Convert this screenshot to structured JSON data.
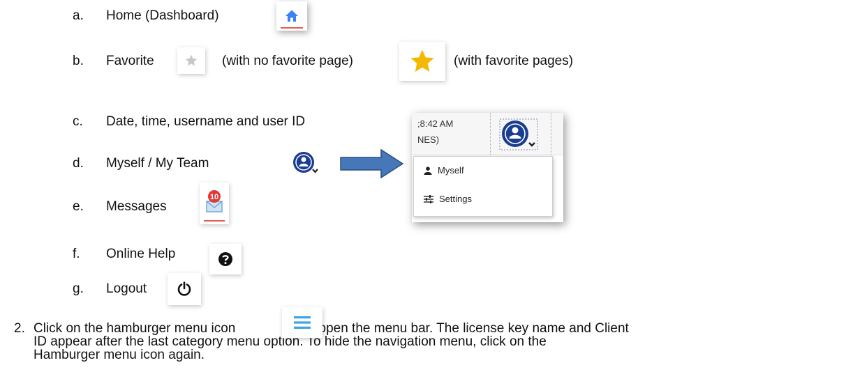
{
  "items": [
    {
      "letter": "a.",
      "label": "Home (Dashboard)",
      "icon": "home-icon"
    },
    {
      "letter": "b.",
      "label": "Favorite",
      "icon": "star-icon",
      "note1": "(with no favorite page)",
      "note2": "(with favorite pages)"
    },
    {
      "letter": "c.",
      "label": "Date, time, username and user ID"
    },
    {
      "letter": "d.",
      "label": "Myself / My Team",
      "icon": "user-avatar-icon"
    },
    {
      "letter": "e.",
      "label": "Messages",
      "icon": "mail-icon",
      "badge": "10"
    },
    {
      "letter": "f.",
      "label": "Online Help",
      "icon": "question-circle-icon"
    },
    {
      "letter": "g.",
      "label": "Logout",
      "icon": "power-icon"
    }
  ],
  "dropdown_example": {
    "time_fragment": ";8:42 AM",
    "name_fragment": "NES)",
    "menu_items": [
      "Myself",
      "Settings"
    ]
  },
  "paragraph": {
    "number": "2.",
    "part1": "Click on the hamburger menu icon",
    "part2": "to open the menu bar. The license key name and Client",
    "line2": "ID appear after the last category menu option. To hide the navigation menu, click on the",
    "line3": "Hamburger menu icon again."
  },
  "colors": {
    "home_blue": "#3b82f6",
    "star_gray": "#c7c7c7",
    "star_gold": "#f5b800",
    "avatar_navy": "#1a3d91",
    "badge_red": "#e53935",
    "arrow_blue": "#4677b8",
    "hamburger_blue": "#3da4e6"
  }
}
